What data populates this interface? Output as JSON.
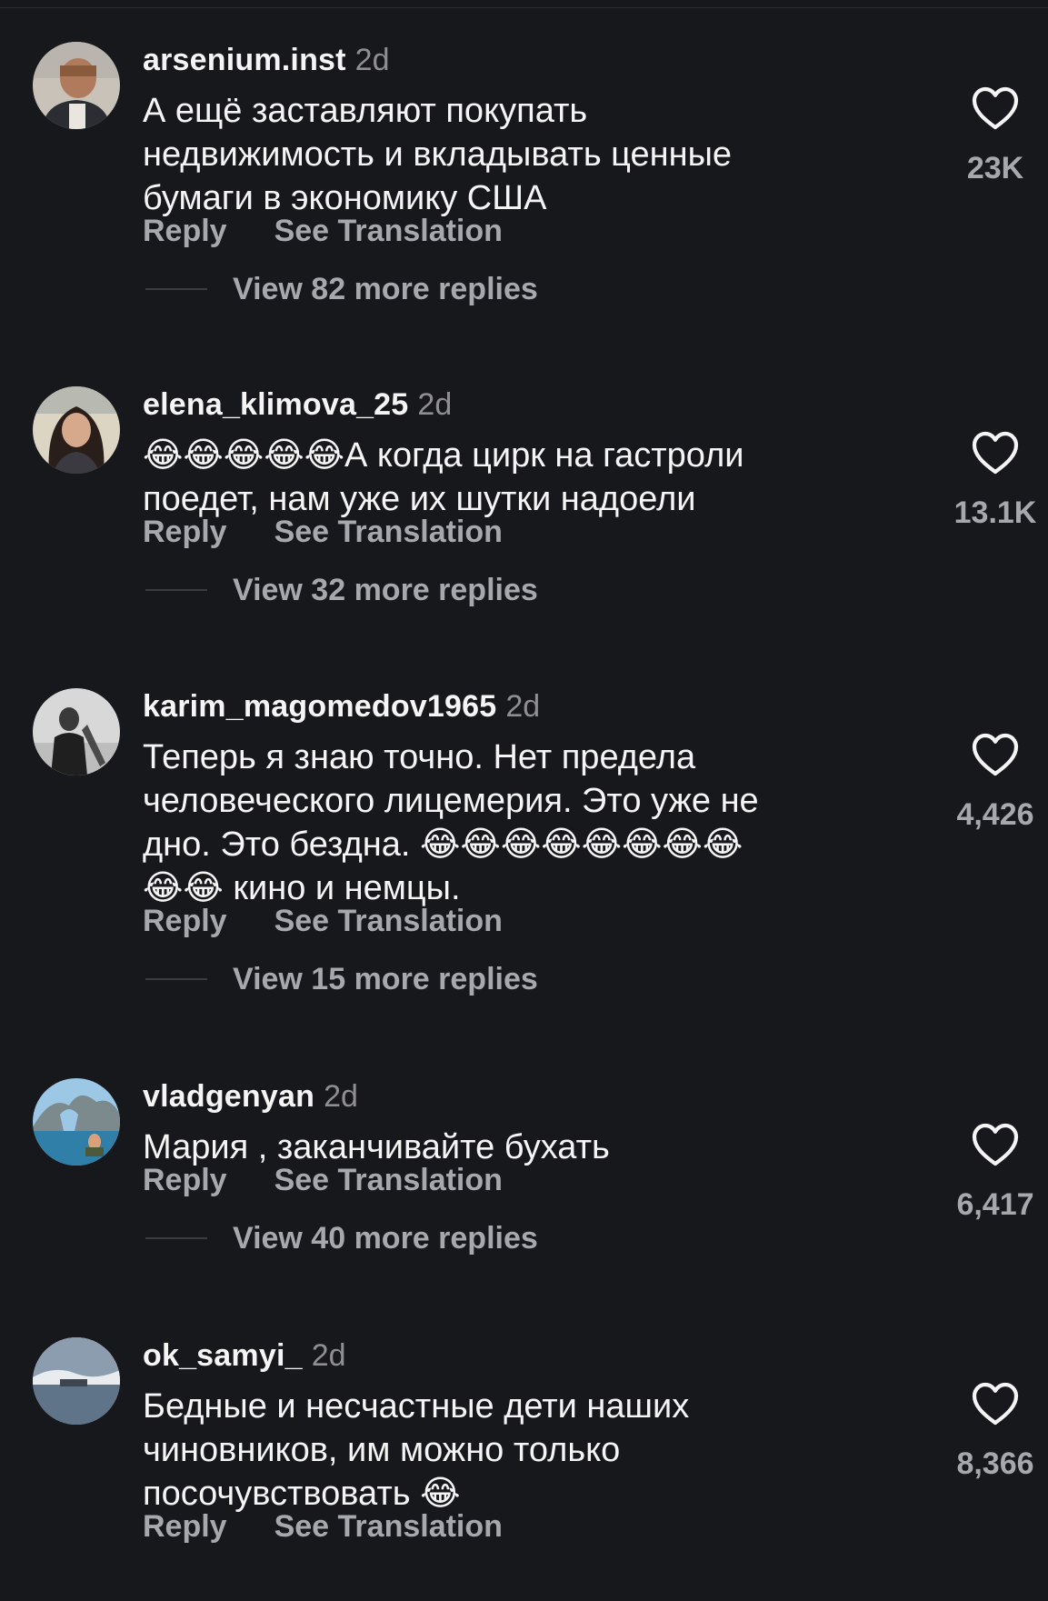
{
  "comments": [
    {
      "username": "arsenium.inst",
      "time": "2d",
      "text": "А ещё заставляют покупать\nнедвижимость и вкладывать ценные\nбумаги в экономику США",
      "reply_label": "Reply",
      "translate_label": "See Translation",
      "replies_label": "View 82 more replies",
      "likes": "23K"
    },
    {
      "username": "elena_klimova_25",
      "time": "2d",
      "text": "😂😂😂😂😂А когда цирк на гастроли\nпоедет, нам уже их шутки надоели",
      "reply_label": "Reply",
      "translate_label": "See Translation",
      "replies_label": "View 32 more replies",
      "likes": "13.1K"
    },
    {
      "username": "karim_magomedov1965",
      "time": "2d",
      "text": "Теперь я знаю точно. Нет предела\nчеловеческого лицемерия. Это уже не\nдно. Это бездна. 😂😂😂😂😂😂😂😂\n😂😂 кино и немцы.",
      "reply_label": "Reply",
      "translate_label": "See Translation",
      "replies_label": "View 15 more replies",
      "likes": "4,426"
    },
    {
      "username": "vladgenyan",
      "time": "2d",
      "text": "Мария , заканчивайте бухать",
      "reply_label": "Reply",
      "translate_label": "See Translation",
      "replies_label": "View 40 more replies",
      "likes": "6,417"
    },
    {
      "username": "ok_samyi_",
      "time": "2d",
      "text": "Бедные и несчастные дети наших\nчиновников, им можно только\nпосочувствовать 😂",
      "reply_label": "Reply",
      "translate_label": "See Translation",
      "likes": "8,366"
    }
  ],
  "icons": {
    "like": "heart-outline-icon"
  },
  "colors": {
    "background": "#17181c",
    "primary_text": "#f5f5f5",
    "secondary_text": "#a7a8ad",
    "timestamp": "#8e8e93"
  }
}
